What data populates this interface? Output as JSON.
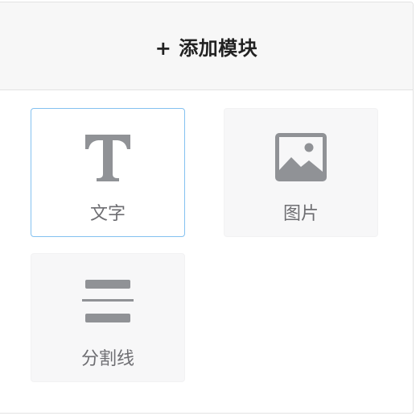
{
  "header": {
    "title": "+ 添加模块"
  },
  "modules": [
    {
      "label": "文字",
      "icon": "text-icon",
      "selected": true
    },
    {
      "label": "图片",
      "icon": "image-icon",
      "selected": false
    },
    {
      "label": "分割线",
      "icon": "divider-icon",
      "selected": false
    }
  ],
  "colors": {
    "icon": "#909296",
    "selected_border": "#84c1f0",
    "card_bg": "#f7f7f8",
    "header_bg": "#f7f7f7"
  }
}
